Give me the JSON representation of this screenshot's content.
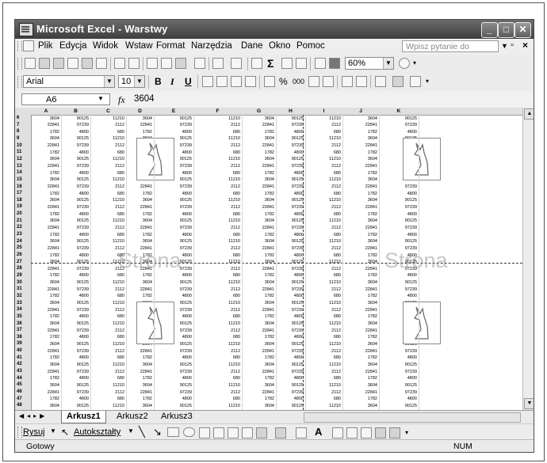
{
  "window": {
    "title": "Microsoft Excel - Warstwy",
    "controls": {
      "minimize": "_",
      "maximize": "□",
      "close": "✕"
    }
  },
  "menubar": {
    "items": [
      "Plik",
      "Edycja",
      "Widok",
      "Wstaw",
      "Format",
      "Narzędzia",
      "Dane",
      "Okno",
      "Pomoc"
    ],
    "help_placeholder": "Wpisz pytanie do Pomocy"
  },
  "toolbar": {
    "zoom": "60%"
  },
  "formatting": {
    "font": "Arial",
    "size": "10",
    "bold": "B",
    "italic": "I",
    "underline": "U",
    "percent": "%",
    "thousands": "000"
  },
  "formula_bar": {
    "cell_ref": "A6",
    "fx": "fx",
    "value": "3604"
  },
  "sheet": {
    "columns": [
      "A",
      "B",
      "C",
      "D",
      "E",
      "F",
      "G",
      "H",
      "I",
      "J",
      "K"
    ],
    "row_numbers": [
      "6",
      "7",
      "8",
      "9",
      "10",
      "11",
      "12",
      "13",
      "14",
      "15",
      "16",
      "17",
      "18",
      "19",
      "20",
      "21",
      "22",
      "23",
      "24",
      "25",
      "26",
      "27",
      "28",
      "29",
      "30",
      "31",
      "32",
      "33",
      "34",
      "35",
      "36",
      "37",
      "38",
      "39",
      "40",
      "41",
      "42",
      "43",
      "44",
      "45",
      "46",
      "47",
      "48"
    ],
    "row_patterns": [
      [
        "3604",
        "90125",
        "11210",
        "3604",
        "90125",
        "11210",
        "3604",
        "90125",
        "11210",
        "3604",
        "90125"
      ],
      [
        "22841",
        "97239",
        "2112",
        "22841",
        "97239",
        "2112",
        "22841",
        "97239",
        "2112",
        "22841",
        "97239"
      ],
      [
        "1782",
        "4800",
        "680",
        "1782",
        "4800",
        "680",
        "1782",
        "4800",
        "680",
        "1782",
        "4800"
      ]
    ],
    "watermark": "Strona"
  },
  "sheet_tabs": {
    "tabs": [
      "Arkusz1",
      "Arkusz2",
      "Arkusz3"
    ]
  },
  "drawing_toolbar": {
    "draw": "Rysuj",
    "autoshapes": "Autokształty"
  },
  "status": {
    "left": "Gotowy",
    "num": "NUM"
  }
}
